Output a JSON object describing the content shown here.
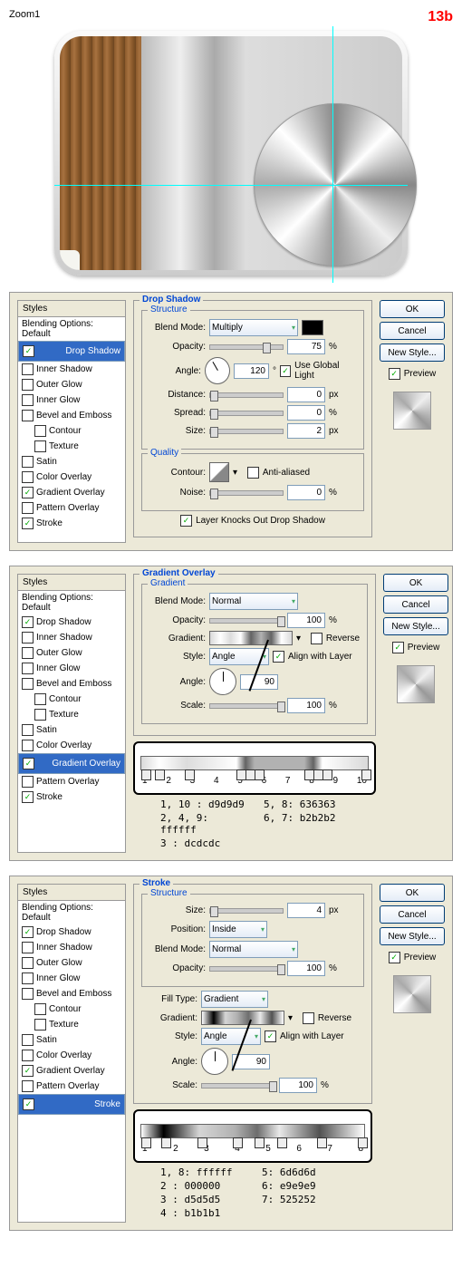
{
  "header": {
    "zoom": "Zoom1",
    "step": "13b"
  },
  "common": {
    "styles_header": "Styles",
    "blending": "Blending Options: Default",
    "items": [
      "Drop Shadow",
      "Inner Shadow",
      "Outer Glow",
      "Inner Glow",
      "Bevel and Emboss",
      "Contour",
      "Texture",
      "Satin",
      "Color Overlay",
      "Gradient Overlay",
      "Pattern Overlay",
      "Stroke"
    ],
    "ok": "OK",
    "cancel": "Cancel",
    "newstyle": "New Style...",
    "preview": "Preview"
  },
  "labels": {
    "blendmode": "Blend Mode:",
    "opacity": "Opacity:",
    "angle": "Angle:",
    "distance": "Distance:",
    "spread": "Spread:",
    "size": "Size:",
    "contour": "Contour:",
    "noise": "Noise:",
    "gradient": "Gradient:",
    "style": "Style:",
    "scale": "Scale:",
    "position": "Position:",
    "filltype": "Fill Type:",
    "ugl": "Use Global Light",
    "aa": "Anti-aliased",
    "lko": "Layer Knocks Out Drop Shadow",
    "rev": "Reverse",
    "awl": "Align with Layer",
    "px": "px",
    "pct": "%",
    "deg": "°"
  },
  "d1": {
    "title": "Drop Shadow",
    "sub1": "Structure",
    "sub2": "Quality",
    "mode": "Multiply",
    "opacity": "75",
    "angle": "120",
    "distance": "0",
    "spread": "0",
    "size": "2",
    "noise": "0",
    "checked": {
      "ds": true,
      "go": true,
      "st": true
    }
  },
  "d2": {
    "title": "Gradient Overlay",
    "sub1": "Gradient",
    "mode": "Normal",
    "opacity": "100",
    "style": "Angle",
    "angle": "90",
    "scale": "100",
    "checked": {
      "ds": true,
      "go": true,
      "st": true
    },
    "stops_n": [
      "1",
      "2",
      "3",
      "4",
      "5",
      "6",
      "7",
      "8",
      "9",
      "10"
    ],
    "colors": [
      [
        "1, 10",
        ": d9d9d9"
      ],
      [
        "5, 8:",
        "636363"
      ],
      [
        "2, 4, 9:",
        "ffffff"
      ],
      [
        "6, 7:",
        "b2b2b2"
      ],
      [
        "3",
        ": dcdcdc"
      ]
    ]
  },
  "d3": {
    "title": "Stroke",
    "sub1": "Structure",
    "size": "4",
    "position": "Inside",
    "mode": "Normal",
    "opacity": "100",
    "filltype": "Gradient",
    "style": "Angle",
    "angle": "90",
    "scale": "100",
    "checked": {
      "ds": true,
      "go": true,
      "st": true
    },
    "stops_n": [
      "1",
      "2",
      "3",
      "4",
      "5",
      "6",
      "7",
      "8"
    ],
    "colors": [
      [
        "1, 8:",
        "ffffff"
      ],
      [
        "5:",
        "6d6d6d"
      ],
      [
        "2   :",
        "000000"
      ],
      [
        "6:",
        "e9e9e9"
      ],
      [
        "3   :",
        "d5d5d5"
      ],
      [
        "7:",
        "525252"
      ],
      [
        "4   :",
        "b1b1b1"
      ]
    ]
  }
}
